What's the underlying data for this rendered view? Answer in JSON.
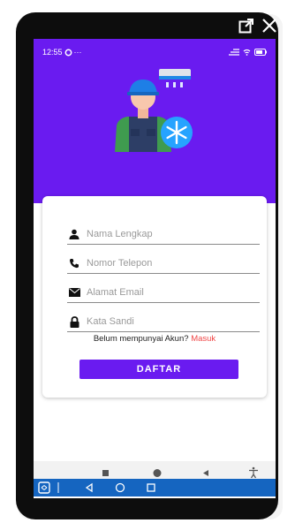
{
  "status_bar": {
    "time": "12:55",
    "dots": "···"
  },
  "form": {
    "name_placeholder": "Nama Lengkap",
    "phone_placeholder": "Nomor Telepon",
    "email_placeholder": "Alamat Email",
    "password_placeholder": "Kata Sandi",
    "login_prompt": "Belum mempunyai Akun?",
    "login_link": "Masuk",
    "submit_label": "DAFTAR"
  },
  "colors": {
    "accent": "#6a1bf0",
    "link": "#f04747",
    "bottom_bar": "#1565c0"
  },
  "icons": {
    "open_external": "open-external-icon",
    "close": "close-icon",
    "person": "person-icon",
    "phone": "phone-icon",
    "mail": "mail-icon",
    "lock": "lock-icon"
  }
}
